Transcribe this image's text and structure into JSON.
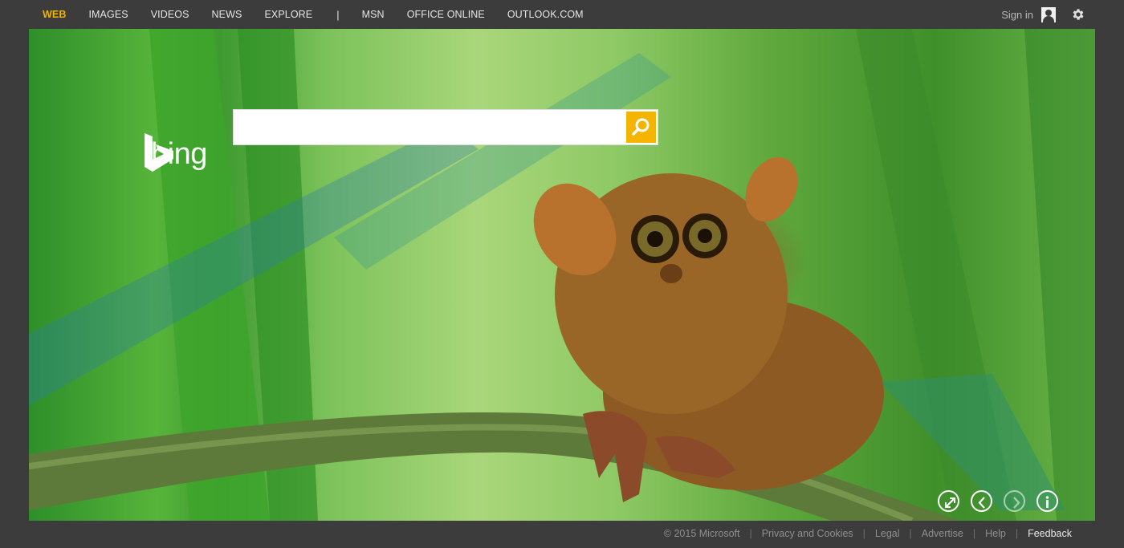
{
  "nav": {
    "items": [
      "WEB",
      "IMAGES",
      "VIDEOS",
      "NEWS",
      "EXPLORE"
    ],
    "separator": "|",
    "external": [
      "MSN",
      "OFFICE ONLINE",
      "OUTLOOK.COM"
    ],
    "active": "WEB"
  },
  "header": {
    "signin_label": "Sign in"
  },
  "brand": {
    "logo_text": "bing"
  },
  "search": {
    "value": "",
    "placeholder": ""
  },
  "footer": {
    "copyright": "© 2015 Microsoft",
    "links": [
      "Privacy and Cookies",
      "Legal",
      "Advertise",
      "Help"
    ],
    "feedback": "Feedback",
    "separator": "|"
  },
  "icons": [
    "user-icon",
    "gear-icon",
    "search-icon",
    "fullscreen-icon",
    "previous-icon",
    "next-icon",
    "info-icon"
  ],
  "colors": {
    "accent": "#f0b400",
    "background": "#3c3c3c",
    "search_button": "#f4b400"
  }
}
